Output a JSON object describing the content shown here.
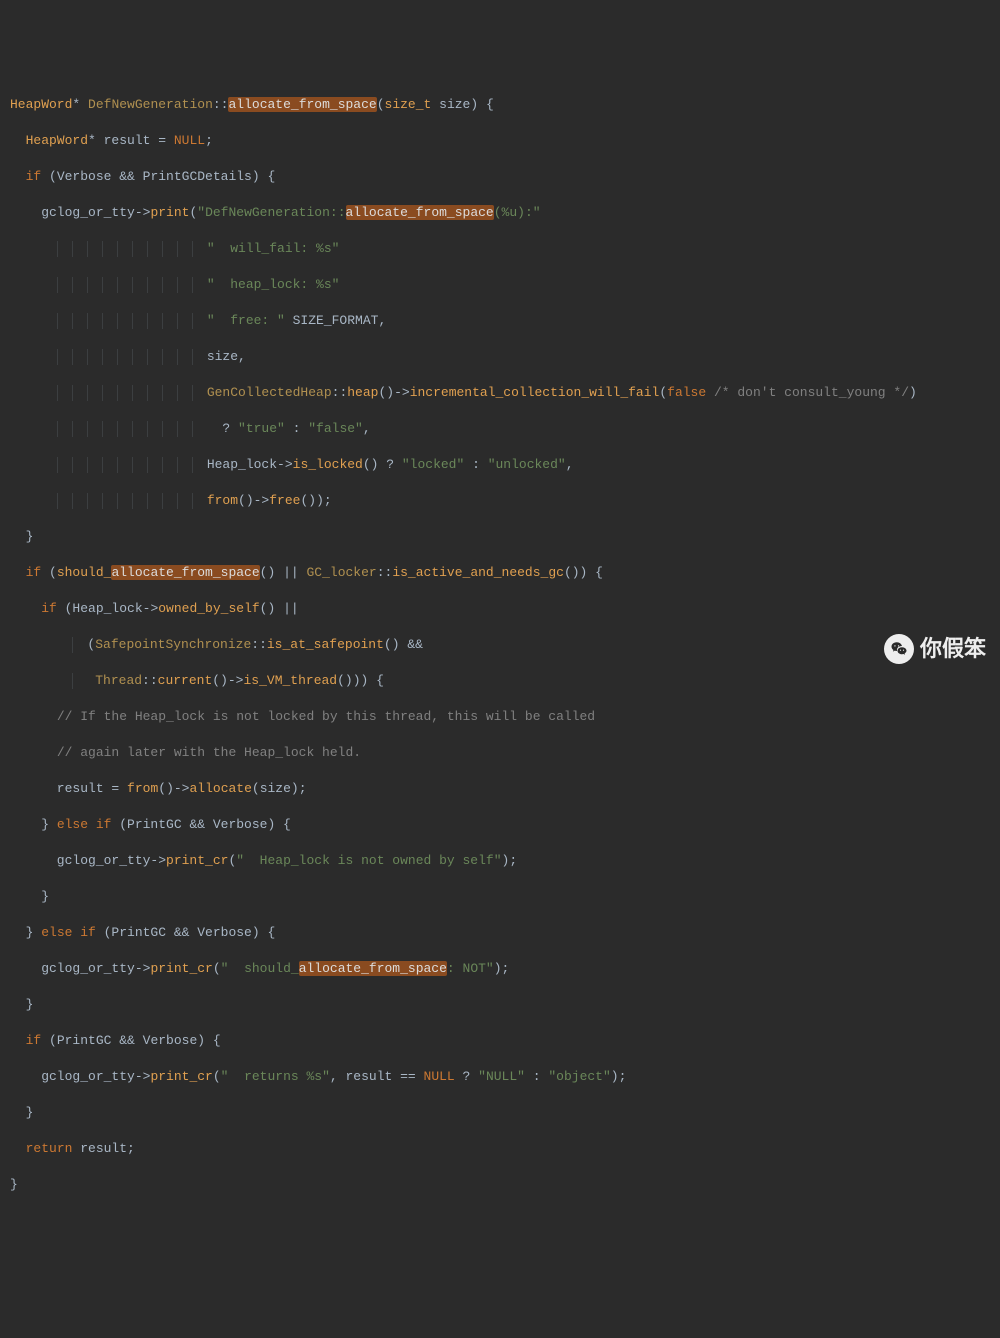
{
  "code": {
    "l1": {
      "a": "HeapWord",
      "b": "*",
      "c": "DefNewGeneration",
      "d": "::",
      "e": "allocate_from_space",
      "f": "(",
      "g": "size_t",
      "h": " size) {"
    },
    "l2": {
      "a": "  HeapWord",
      "b": "* result ",
      "c": "=",
      "d": " ",
      "e": "NULL",
      "f": ";"
    },
    "l3": {
      "a": "  ",
      "b": "if",
      "c": " (Verbose ",
      "d": "&&",
      "e": " PrintGCDetails) {"
    },
    "l4": {
      "a": "    gclog_or_tty->",
      "b": "print",
      "c": "(",
      "d": "\"DefNewGeneration::",
      "e": "allocate_from_space",
      "f": "(%u):\""
    },
    "l5": {
      "a": "\"  will_fail: %s\""
    },
    "l6": {
      "a": "\"  heap_lock: %s\""
    },
    "l7": {
      "a": "\"  free: \"",
      "b": " SIZE_FORMAT,"
    },
    "l8": {
      "a": "size,"
    },
    "l9": {
      "a": "GenCollectedHeap",
      "b": "::",
      "c": "heap",
      "d": "()->",
      "e": "incremental_collection_will_fail",
      "f": "(",
      "g": "false",
      "h": " ",
      "i": "/* don't consult_young */",
      "j": ")"
    },
    "l10": {
      "a": "? ",
      "b": "\"true\"",
      "c": " : ",
      "d": "\"false\"",
      "e": ","
    },
    "l11": {
      "a": "Heap_lock->",
      "b": "is_locked",
      "c": "() ? ",
      "d": "\"locked\"",
      "e": " : ",
      "f": "\"unlocked\"",
      "g": ","
    },
    "l12": {
      "a": "from",
      "b": "()->",
      "c": "free",
      "d": "());"
    },
    "l13": {
      "a": "  }"
    },
    "l14": {
      "a": "  ",
      "b": "if",
      "c": " (",
      "d": "should_",
      "e": "allocate_from_space",
      "f": "() || ",
      "g": "GC_locker",
      "h": "::",
      "i": "is_active_and_needs_gc",
      "j": "()) {"
    },
    "l15": {
      "a": "    ",
      "b": "if",
      "c": " (Heap_lock->",
      "d": "owned_by_self",
      "e": "() ||"
    },
    "l16": {
      "a": "(",
      "b": "SafepointSynchronize",
      "c": "::",
      "d": "is_at_safepoint",
      "e": "() ",
      "f": "&&"
    },
    "l17": {
      "a": "Thread",
      "b": "::",
      "c": "current",
      "d": "()->",
      "e": "is_VM_thread",
      "f": "())) {"
    },
    "l18": {
      "a": "// If the Heap_lock is not locked by this thread, this will be called"
    },
    "l19": {
      "a": "// again later with the Heap_lock held."
    },
    "l20": {
      "a": "      result ",
      "b": "=",
      "c": " ",
      "d": "from",
      "e": "()->",
      "f": "allocate",
      "g": "(size);"
    },
    "l21": {
      "a": "    } ",
      "b": "else if",
      "c": " (PrintGC ",
      "d": "&&",
      "e": " Verbose) {"
    },
    "l22": {
      "a": "      gclog_or_tty->",
      "b": "print_cr",
      "c": "(",
      "d": "\"  Heap_lock is not owned by self\"",
      "e": ");"
    },
    "l23": {
      "a": "    }"
    },
    "l24": {
      "a": "  } ",
      "b": "else if",
      "c": " (PrintGC ",
      "d": "&&",
      "e": " Verbose) {"
    },
    "l25": {
      "a": "    gclog_or_tty->",
      "b": "print_cr",
      "c": "(",
      "d": "\"  should_",
      "e": "allocate_from_space",
      "f": ": NOT\"",
      "g": ");"
    },
    "l26": {
      "a": "  }"
    },
    "l27": {
      "a": "  ",
      "b": "if",
      "c": " (PrintGC ",
      "d": "&&",
      "e": " Verbose) {"
    },
    "l28": {
      "a": "    gclog_or_tty->",
      "b": "print_cr",
      "c": "(",
      "d": "\"  returns %s\"",
      "e": ", result ",
      "f": "==",
      "g": " ",
      "h": "NULL",
      "i": " ? ",
      "j": "\"NULL\"",
      "k": " : ",
      "l": "\"object\"",
      "m": ");"
    },
    "l29": {
      "a": "  }"
    },
    "l30": {
      "a": "  ",
      "b": "return",
      "c": " result;"
    },
    "l31": {
      "a": "}"
    }
  },
  "watermark": {
    "text": "你假笨"
  }
}
